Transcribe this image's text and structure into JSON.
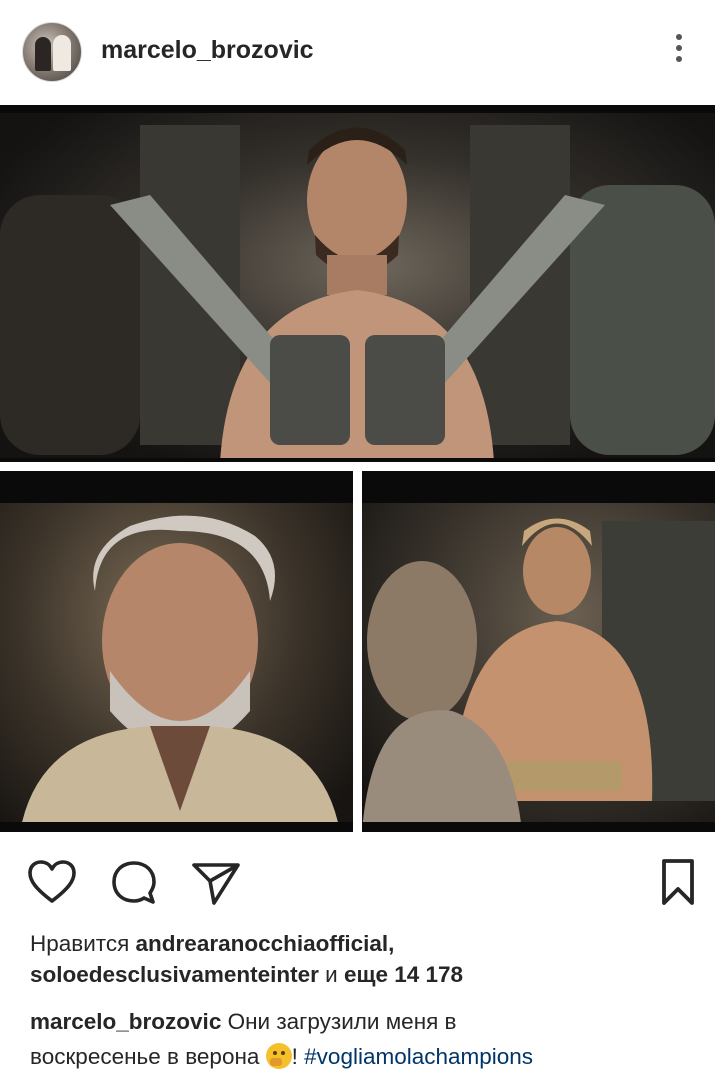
{
  "header": {
    "username": "marcelo_brozovic",
    "avatar_icon": "profile-avatar",
    "more_icon": "more-vertical-icon"
  },
  "post": {
    "image_panels": [
      {
        "name": "top-panel"
      },
      {
        "name": "bottom-left-panel"
      },
      {
        "name": "bottom-right-panel"
      }
    ]
  },
  "actions": {
    "like_icon": "heart-icon",
    "comment_icon": "comment-icon",
    "share_icon": "send-icon",
    "save_icon": "bookmark-icon"
  },
  "likes": {
    "prefix": "Нравится ",
    "user1": "andrearanocchiaofficial,",
    "user2": "soloedesclusivamenteinter",
    "mid": " и ",
    "more": "еще 14 178"
  },
  "caption": {
    "author": "marcelo_brozovic",
    "text1": " Они загрузили меня в",
    "text2": "воскресенье в верона ",
    "text3": "! ",
    "hashtag": "#vogliamolachampions"
  },
  "colors": {
    "text": "#262626",
    "hashtag": "#003569",
    "background": "#ffffff"
  }
}
